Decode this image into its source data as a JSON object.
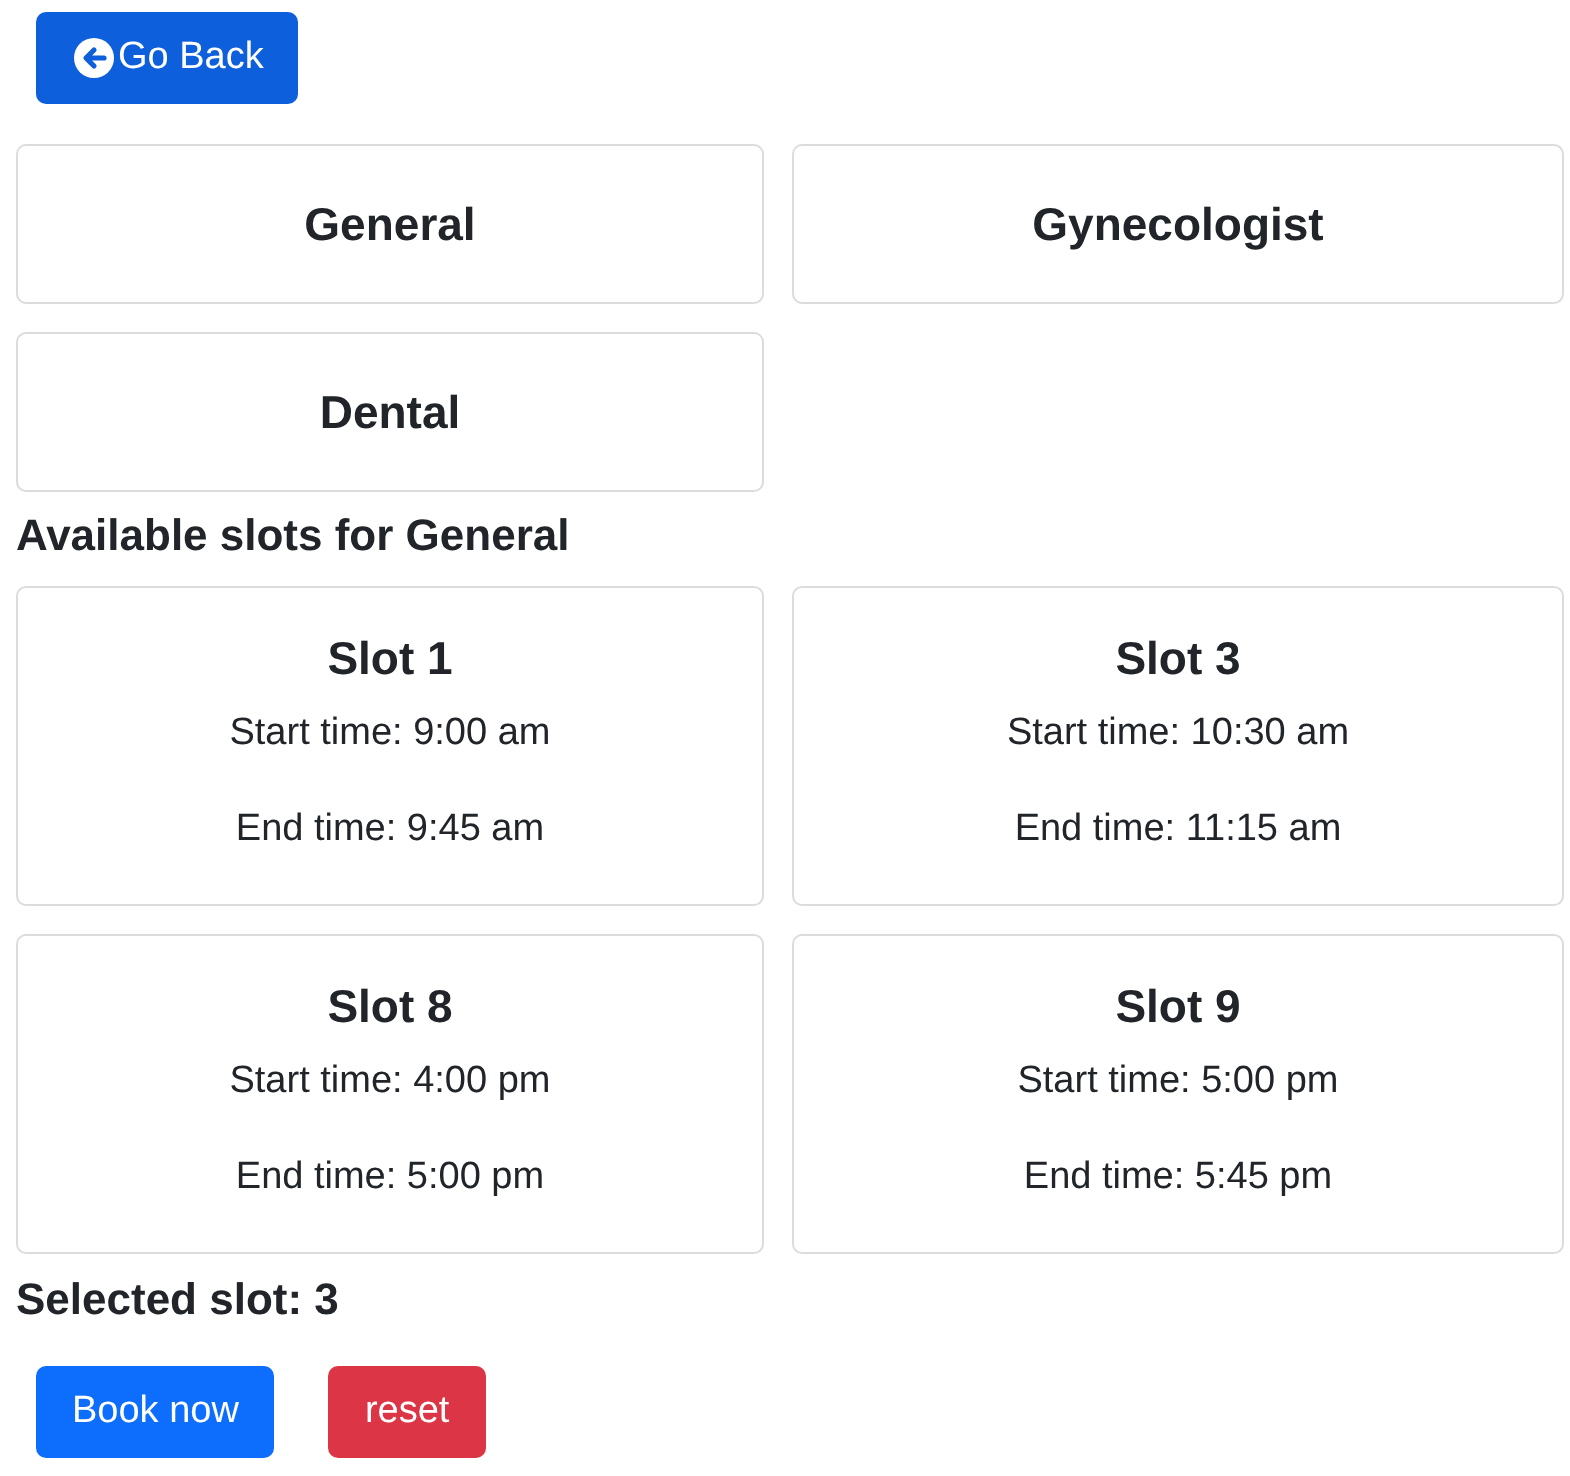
{
  "back_button": {
    "label": "Go Back"
  },
  "categories": [
    {
      "label": "General"
    },
    {
      "label": "Gynecologist"
    },
    {
      "label": "Dental"
    }
  ],
  "slots_heading": "Available slots for General",
  "slots": [
    {
      "title": "Slot 1",
      "start": "Start time: 9:00 am",
      "end": "End time: 9:45 am"
    },
    {
      "title": "Slot 3",
      "start": "Start time: 10:30 am",
      "end": "End time: 11:15 am"
    },
    {
      "title": "Slot 8",
      "start": "Start time: 4:00 pm",
      "end": "End time: 5:00 pm"
    },
    {
      "title": "Slot 9",
      "start": "Start time: 5:00 pm",
      "end": "End time: 5:45 pm"
    }
  ],
  "selected_text": "Selected slot: 3",
  "buttons": [
    {
      "kind": "primary",
      "label": "Book now"
    },
    {
      "kind": "danger",
      "label": "reset"
    }
  ]
}
